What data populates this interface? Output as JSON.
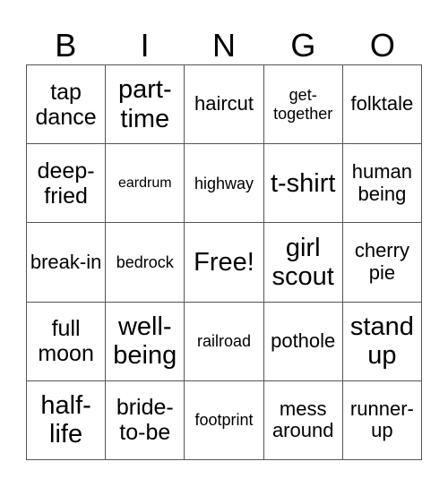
{
  "card": {
    "header": [
      "B",
      "I",
      "N",
      "G",
      "O"
    ],
    "rows": [
      [
        {
          "text": "tap dance",
          "size": "l"
        },
        {
          "text": "part-time",
          "size": "xl"
        },
        {
          "text": "haircut",
          "size": "m"
        },
        {
          "text": "get-together",
          "size": "s"
        },
        {
          "text": "folktale",
          "size": "m"
        }
      ],
      [
        {
          "text": "deep-fried",
          "size": "l"
        },
        {
          "text": "eardrum",
          "size": "xs"
        },
        {
          "text": "highway",
          "size": "s"
        },
        {
          "text": "t-shirt",
          "size": "xl"
        },
        {
          "text": "human being",
          "size": "m"
        }
      ],
      [
        {
          "text": "break-in",
          "size": "m"
        },
        {
          "text": "bedrock",
          "size": "s"
        },
        {
          "text": "Free!",
          "size": "xl"
        },
        {
          "text": "girl scout",
          "size": "xl"
        },
        {
          "text": "cherry pie",
          "size": "m"
        }
      ],
      [
        {
          "text": "full moon",
          "size": "l"
        },
        {
          "text": "well-being",
          "size": "xl"
        },
        {
          "text": "railroad",
          "size": "s"
        },
        {
          "text": "pothole",
          "size": "m"
        },
        {
          "text": "stand up",
          "size": "xl"
        }
      ],
      [
        {
          "text": "half-life",
          "size": "xl"
        },
        {
          "text": "bride-to-be",
          "size": "l"
        },
        {
          "text": "footprint",
          "size": "s"
        },
        {
          "text": "mess around",
          "size": "m"
        },
        {
          "text": "runner-up",
          "size": "m"
        }
      ]
    ]
  }
}
